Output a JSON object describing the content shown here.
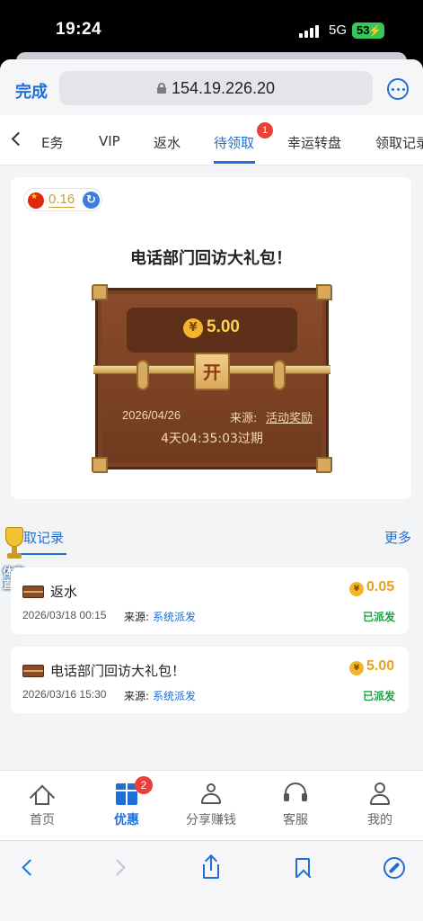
{
  "status_bar": {
    "time": "19:24",
    "network": "5G",
    "battery": "53"
  },
  "browser": {
    "done_label": "完成",
    "url": "154.19.226.20"
  },
  "tabs": [
    {
      "label": "任务",
      "visible_label": "E务"
    },
    {
      "label": "VIP"
    },
    {
      "label": "返水"
    },
    {
      "label": "待领取",
      "badge": "1",
      "active": true
    },
    {
      "label": "幸运转盘"
    },
    {
      "label": "领取记录"
    }
  ],
  "balance": "0.16",
  "gift": {
    "title": "电话部门回访大礼包！",
    "chest_button": "开",
    "amount": "5.00",
    "date": "2026/04/26",
    "source_label": "来源:",
    "source": "活动奖励",
    "expire": "4天04:35:03过期"
  },
  "records": {
    "tab_label": "领取记录",
    "visible_tab_label": "取记录",
    "more_label": "更多",
    "items": [
      {
        "title": "返水",
        "amount": "0.05",
        "date": "2026/03/18 00:15",
        "source_label": "来源:",
        "source": "系统派发",
        "status": "已派发"
      },
      {
        "title": "电话部门回访大礼包！",
        "amount": "5.00",
        "date": "2026/03/16 15:30",
        "source_label": "来源:",
        "source": "系统派发",
        "status": "已派发"
      }
    ]
  },
  "floating_badge": {
    "label_line1": "体育",
    "label_line2": "直播"
  },
  "bottom_nav": [
    {
      "label": "首页",
      "icon": "home-icon"
    },
    {
      "label": "优惠",
      "icon": "gift-icon",
      "badge": "2",
      "active": true
    },
    {
      "label": "分享赚钱",
      "icon": "share-people-icon"
    },
    {
      "label": "客服",
      "icon": "headset-icon"
    },
    {
      "label": "我的",
      "icon": "user-icon"
    }
  ],
  "toolbar": {
    "icons": [
      "back-icon",
      "forward-icon",
      "share-icon",
      "bookmarks-icon",
      "compass-icon"
    ]
  },
  "colors": {
    "accent": "#1f6fd6",
    "gold": "#e6a21c",
    "success": "#1aa340",
    "badge_red": "#e8413a"
  }
}
